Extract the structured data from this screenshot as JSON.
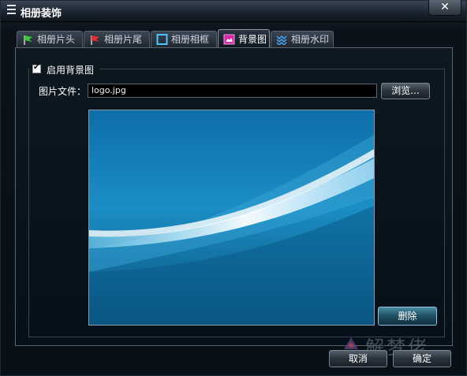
{
  "window": {
    "title": "相册装饰",
    "close_symbol": "✕"
  },
  "tabs": [
    {
      "label": "相册片头",
      "icon": "green-flag-icon",
      "active": false
    },
    {
      "label": "相册片尾",
      "icon": "red-flag-icon",
      "active": false
    },
    {
      "label": "相册相框",
      "icon": "frame-icon",
      "active": false
    },
    {
      "label": "背景图",
      "icon": "image-icon",
      "active": true
    },
    {
      "label": "相册水印",
      "icon": "watermark-icon",
      "active": false
    }
  ],
  "background": {
    "enable_label": "启用背景图",
    "enabled": true,
    "file_label": "图片文件：",
    "file_value": "logo.jpg",
    "browse_label": "浏览...",
    "delete_label": "删除"
  },
  "footer": {
    "cancel_label": "取消",
    "ok_label": "确定"
  },
  "watermark": {
    "text": "解梦佬"
  },
  "colors": {
    "accent": "#1a86c4",
    "panel_border": "#5a6470",
    "background": "#07111a"
  }
}
